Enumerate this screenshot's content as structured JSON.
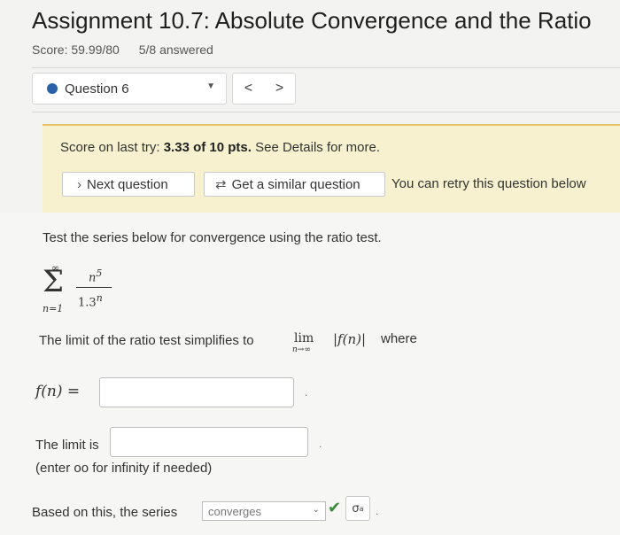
{
  "header": {
    "title": "Assignment 10.7: Absolute Convergence and the Ratio",
    "score": "Score: 59.99/80",
    "answered": "5/8 answered"
  },
  "question_nav": {
    "selected": "Question 6",
    "prev_label": "<",
    "next_label": ">"
  },
  "feedback": {
    "score_prefix": "Score on last try: ",
    "score_bold": "3.33 of 10 pts.",
    "score_suffix": " See Details for more.",
    "next_question": "Next question",
    "similar_question": "Get a similar question",
    "retry_note": "You can retry this question below"
  },
  "problem": {
    "instruction": "Test the series below for convergence using the ratio test.",
    "sum_upper": "∞",
    "sum_lower": "n=1",
    "numerator": "n",
    "numerator_exp": "5",
    "denominator": "1.3",
    "denominator_exp": "n",
    "limit_text": "The limit of the ratio test simplifies to",
    "lim_word": "lim",
    "lim_sub": "n→∞",
    "lim_expr": "|f(n)|",
    "lim_where": "where",
    "fn_label": "f(n) =",
    "fn_value": "",
    "limit_label": "The limit is",
    "limit_value": "",
    "hint": "(enter oo for infinity if needed)",
    "conclusion_label": "Based on this, the series",
    "conclusion_selected": "converges"
  },
  "colors": {
    "accent_blue": "#2a60a8",
    "panel_yellow": "#f7f1cf",
    "panel_border": "#e9c16a",
    "check_green": "#3a8a3a"
  },
  "icons": {
    "status_dot": "filled-circle",
    "next": "chevron-right-icon",
    "similar": "refresh-icon",
    "select_caret": "caret-down-icon",
    "correct": "check-icon",
    "keyboard": "math-key-icon"
  }
}
